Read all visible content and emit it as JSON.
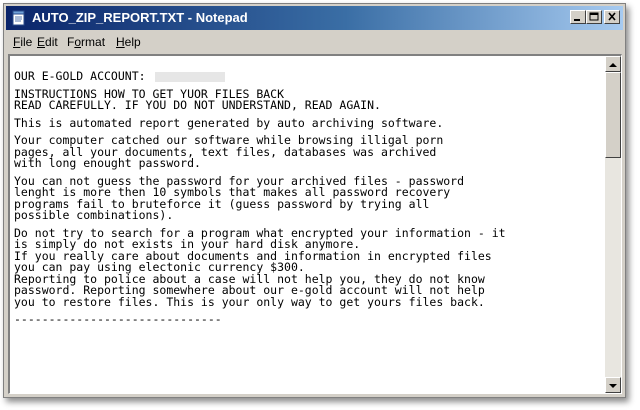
{
  "window": {
    "title": "AUTO_ZIP_REPORT.TXT - Notepad",
    "icon": "notepad-icon",
    "controls": {
      "minimize": "minimize-icon",
      "maximize": "maximize-icon",
      "close": "close-icon"
    }
  },
  "menu": {
    "items": [
      {
        "accel": "F",
        "rest": "ile"
      },
      {
        "accel": "E",
        "rest": "dit"
      },
      {
        "accel": "",
        "pre": "F",
        "mid": "o",
        "post": "rmat"
      },
      {
        "accel": "H",
        "rest": "elp"
      }
    ]
  },
  "document": {
    "p1": [
      "OUR E-GOLD ACCOUNT:"
    ],
    "p2": [
      "INSTRUCTIONS HOW TO GET YUOR FILES BACK",
      "READ CAREFULLY. IF YOU DO NOT UNDERSTAND, READ AGAIN."
    ],
    "p3": [
      "This is automated report generated by auto archiving software."
    ],
    "p4": [
      "Your computer catched our software while browsing illigal porn",
      "pages, all your documents, text files, databases was archived",
      "with long enought password."
    ],
    "p5": [
      "You can not guess the password for your archived files - password",
      "lenght is more then 10 symbols that makes all password recovery",
      "programs fail to bruteforce it (guess password by trying all",
      "possible combinations)."
    ],
    "p6": [
      "Do not try to search for a program what encrypted your information - it",
      "is simply do not exists in your hard disk anymore.",
      "If you really care about documents and information in encrypted files",
      "you can pay using electonic currency $300.",
      "Reporting to police about a case will not help you, they do not know",
      "password. Reporting somewhere about our e-gold account will not help",
      "you to restore files. This is your only way to get yours files back."
    ],
    "p7": [
      "------------------------------"
    ]
  },
  "colors": {
    "titlebar_start": "#0a246a",
    "titlebar_end": "#a6caf0",
    "chrome": "#d4d0c8"
  }
}
